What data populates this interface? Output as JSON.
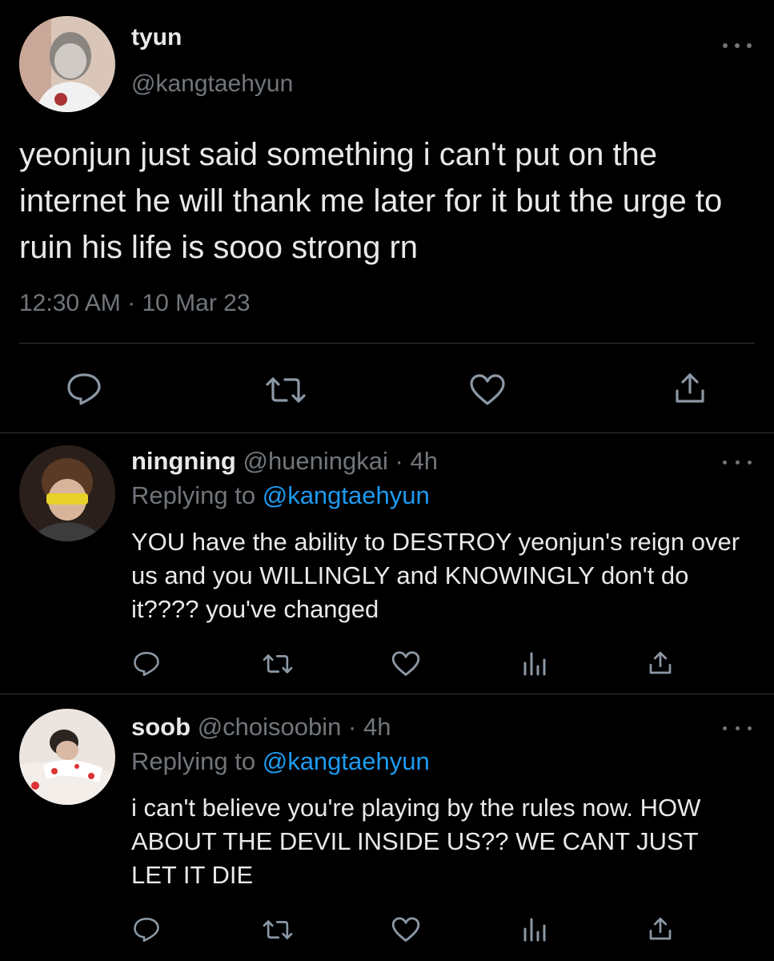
{
  "main_tweet": {
    "display_name": "tyun",
    "handle": "@kangtaehyun",
    "text": "yeonjun just said something i can't put on the internet he will thank me later for it but the urge to ruin his life is sooo strong rn",
    "time": "12:30 AM",
    "separator": "·",
    "date": "10 Mar 23"
  },
  "replies": [
    {
      "display_name": "ningning",
      "handle": "@hueningkai",
      "separator": "·",
      "age": "4h",
      "replying_prefix": "Replying to",
      "replying_to": "@kangtaehyun",
      "text": "YOU have the ability to DESTROY yeonjun's reign over us and you WILLINGLY and KNOWINGLY don't do it???? you've changed"
    },
    {
      "display_name": "soob",
      "handle": "@choisoobin",
      "separator": "·",
      "age": "4h",
      "replying_prefix": "Replying to",
      "replying_to": "@kangtaehyun",
      "text": "i can't believe you're playing by the rules now. HOW ABOUT THE DEVIL INSIDE US?? WE CANT JUST LET IT DIE"
    }
  ],
  "icons": [
    "reply-icon",
    "retweet-icon",
    "like-icon",
    "share-icon",
    "views-icon",
    "more-icon"
  ],
  "colors": {
    "background": "#000000",
    "text": "#e7e9ea",
    "muted": "#71767b",
    "link": "#1d9bf0",
    "divider": "#2f3336"
  }
}
